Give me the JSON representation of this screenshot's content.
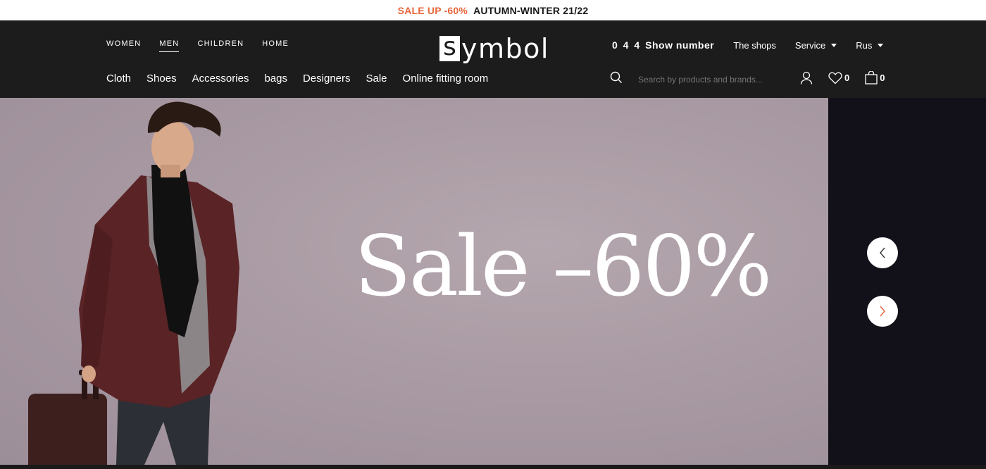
{
  "promo": {
    "sale": "SALE UP -60%",
    "season": "AUTUMN-WINTER 21/22"
  },
  "gender_nav": [
    {
      "label": "WOMEN",
      "active": false
    },
    {
      "label": "MEN",
      "active": true
    },
    {
      "label": "CHILDREN",
      "active": false
    },
    {
      "label": "HOME",
      "active": false
    }
  ],
  "logo": {
    "first_letter": "s",
    "rest": "ymbol"
  },
  "utility": {
    "phone_number": "0 4 4",
    "phone_action": "Show number",
    "shops": "The shops",
    "service": "Service",
    "language": "Rus"
  },
  "category_nav": [
    "Cloth",
    "Shoes",
    "Accessories",
    "bags",
    "Designers",
    "Sale",
    "Online fitting room"
  ],
  "search": {
    "placeholder": "Search by products and brands..."
  },
  "counts": {
    "wishlist": "0",
    "cart": "0"
  },
  "hero": {
    "title": "Sale –60%"
  },
  "icons": {
    "search": "search-icon",
    "account": "user-icon",
    "wishlist": "heart-icon",
    "cart": "bag-icon",
    "prev": "chevron-left-icon",
    "next": "chevron-right-icon"
  },
  "colors": {
    "accent": "#e8663a",
    "header_bg": "#1c1c1c",
    "hero_bg": "#a99aa3"
  }
}
